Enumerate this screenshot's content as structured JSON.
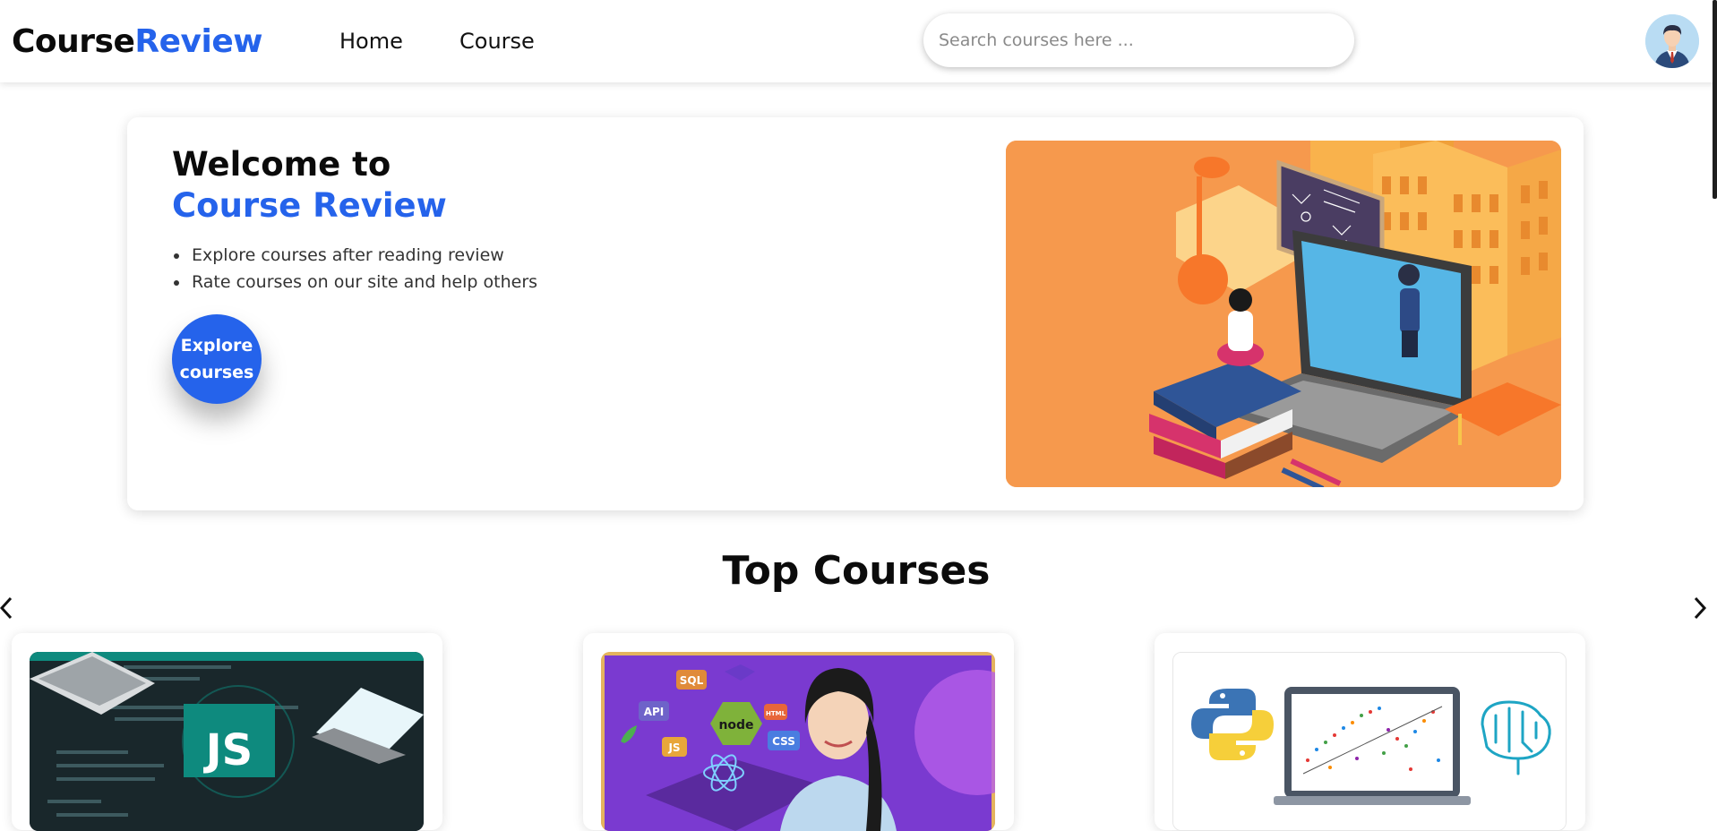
{
  "brand": {
    "part1": "Course",
    "part2": "Review"
  },
  "nav": {
    "home": "Home",
    "course": "Course"
  },
  "search": {
    "placeholder": "Search courses here ..."
  },
  "hero": {
    "title_line1": "Welcome to",
    "title_line2": "Course Review",
    "bullets": [
      "Explore courses after reading review",
      "Rate courses on our site and help others"
    ],
    "button_line1": "Explore",
    "button_line2": "courses"
  },
  "top_courses": {
    "title": "Top Courses"
  },
  "courses": [
    {
      "image_label": "JS"
    },
    {
      "image_badges": [
        "API",
        "SQL",
        "JS",
        "node",
        "CSS",
        "HTML"
      ]
    },
    {
      "image": "python-data-science"
    }
  ],
  "colors": {
    "accent": "#2563eb",
    "hero_bg": "#f6994d"
  }
}
